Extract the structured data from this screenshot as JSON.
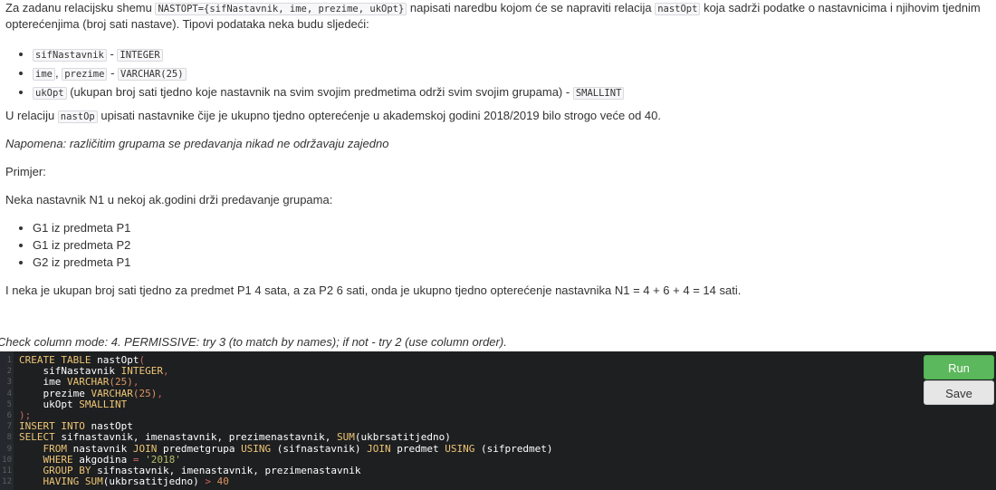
{
  "task": {
    "intro_pre": "Za zadanu relacijsku shemu ",
    "intro_code1": "NASTOPT={sifNastavnik, ime, prezime, ukOpt}",
    "intro_mid": " napisati naredbu kojom će se napraviti relacija ",
    "intro_code2": "nastOpt",
    "intro_post": " koja sadrži podatke o nastavnicima i njihovim tjednim",
    "intro_line2": "opterećenjima (broj sati nastave). Tipovi podataka neka budu sljedeći:",
    "types": [
      {
        "c1": "sifNastavnik",
        "sep1": " - ",
        "c2": "INTEGER"
      },
      {
        "c1": "ime",
        "comma": ", ",
        "c3": "prezime",
        "sep1": " - ",
        "c2": "VARCHAR(25)"
      },
      {
        "c1": "ukOpt",
        "text": " (ukupan broj sati tjedno koje nastavnik na svim svojim predmetima održi svim svojim grupama) - ",
        "c2": "SMALLINT"
      }
    ],
    "rel_pre": "U relaciju ",
    "rel_code": "nastOp",
    "rel_post": " upisati nastavnike čije je ukupno tjedno opterećenje u akademskoj godini 2018/2019 bilo strogo veće od 40.",
    "note": "Napomena: različitim grupama se predavanja nikad ne održavaju zajedno",
    "example": "Primjer:",
    "example_intro": "Neka nastavnik N1 u nekoj ak.godini drži predavanje grupama:",
    "groups": [
      "G1 iz predmeta P1",
      "G1 iz predmeta P2",
      "G2 iz predmeta P1"
    ],
    "conclusion": "I neka je ukupan broj sati tjedno za predmet P1 4 sata, a za P2 6 sati, onda je ukupno tjedno opterećenje nastavnika N1 = 4 + 6 + 4 = 14 sati.",
    "check_mode": "Check column mode: 4. PERMISSIVE: try 3 (to match by names); if not - try 2 (use column order)."
  },
  "editor": {
    "line_numbers": [
      "1",
      "2",
      "3",
      "4",
      "5",
      "6",
      "7",
      "8",
      "9",
      "10",
      "11",
      "12"
    ],
    "tokens": {
      "l1a": "CREATE TABLE",
      "l1b": " nastOpt",
      "l1c": "(",
      "l2a": "    sifNastavnik ",
      "l2b": "INTEGER",
      "l2c": ",",
      "l3a": "    ime ",
      "l3b": "VARCHAR",
      "l3c": "(25)",
      "l3d": ",",
      "l4a": "    prezime ",
      "l4b": "VARCHAR",
      "l4c": "(25)",
      "l4d": ",",
      "l5a": "    ukOpt ",
      "l5b": "SMALLINT",
      "l6a": ");",
      "l7a": "INSERT INTO",
      "l7b": " nastOpt",
      "l8a": "SELECT",
      "l8b": " sifnastavnik, imenastavnik, prezimenastavnik, ",
      "l8c": "SUM",
      "l8d": "(ukbrsatitjedno)",
      "l9a": "    FROM",
      "l9b": " nastavnik ",
      "l9c": "JOIN",
      "l9d": " predmetgrupa ",
      "l9e": "USING",
      "l9f": " (sifnastavnik) ",
      "l9g": "JOIN",
      "l9h": " predmet ",
      "l9i": "USING",
      "l9j": " (sifpredmet)",
      "l10a": "    WHERE",
      "l10b": " akgodina ",
      "l10c": "=",
      "l10d": " '2018'",
      "l11a": "    GROUP BY",
      "l11b": " sifnastavnik, imenastavnik, prezimenastavnik",
      "l12a": "    HAVING",
      "l12b": " ",
      "l12c": "SUM",
      "l12d": "(ukbrsatitjedno) ",
      "l12e": ">",
      "l12f": " 40"
    }
  },
  "buttons": {
    "run": "Run",
    "save": "Save"
  }
}
